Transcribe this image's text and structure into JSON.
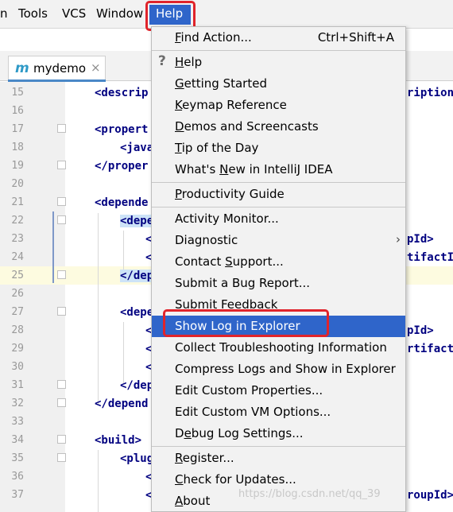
{
  "menubar": {
    "items": [
      "n",
      "Tools",
      "VCS",
      "Window"
    ],
    "active": "Help"
  },
  "tab": {
    "logo": "m",
    "label": "mydemo",
    "close": "×"
  },
  "editor": {
    "line_numbers": [
      "15",
      "16",
      "17",
      "18",
      "19",
      "20",
      "21",
      "22",
      "23",
      "24",
      "25",
      "26",
      "27",
      "28",
      "29",
      "30",
      "31",
      "32",
      "33",
      "34",
      "35",
      "36",
      "37"
    ],
    "left_code": {
      "l15": "<descrip",
      "l17": "<propert",
      "l18": "<java",
      "l19": "</proper",
      "l21": "<depende",
      "l22": "<depe",
      "l23": "<",
      "l24": "<",
      "l25": "</dep",
      "l27": "<depe",
      "l28": "<",
      "l29": "<",
      "l30": "<",
      "l31": "</dep",
      "l32": "</depend",
      "l34": "<build>",
      "l35": "<plug",
      "l36": "<",
      "l37": "<"
    },
    "right_code": {
      "l15": "ription",
      "l22": "pId>",
      "l23": "tifactI",
      "l28": "pId>",
      "l29": "rtifact",
      "l37": "roupId>"
    },
    "watermark": "https://blog.csdn.net/qq_39"
  },
  "help_menu": {
    "groups": [
      [
        {
          "label": "Find Action...",
          "mnemonic": "F",
          "shortcut": "Ctrl+Shift+A"
        }
      ],
      [
        {
          "label": "Help",
          "mnemonic": "H",
          "icon": "?"
        },
        {
          "label": "Getting Started",
          "mnemonic": "G"
        },
        {
          "label": "Keymap Reference",
          "mnemonic": "K"
        },
        {
          "label": "Demos and Screencasts",
          "mnemonic": "D"
        },
        {
          "label": "Tip of the Day",
          "mnemonic": "T"
        },
        {
          "label": "What's New in IntelliJ IDEA",
          "mnemonic": "N"
        }
      ],
      [
        {
          "label": "Productivity Guide",
          "mnemonic": "P"
        }
      ],
      [
        {
          "label": "Activity Monitor..."
        },
        {
          "label": "Diagnostic",
          "submenu": true
        },
        {
          "label": "Contact Support...",
          "mnemonic": "S"
        },
        {
          "label": "Submit a Bug Report..."
        },
        {
          "label": "Submit Feedback"
        },
        {
          "label": "Show Log in Explorer",
          "selected": true
        },
        {
          "label": "Collect Troubleshooting Information"
        },
        {
          "label": "Compress Logs and Show in Explorer"
        },
        {
          "label": "Edit Custom Properties..."
        },
        {
          "label": "Edit Custom VM Options..."
        },
        {
          "label": "Debug Log Settings...",
          "mnemonic": "e"
        }
      ],
      [
        {
          "label": "Register...",
          "mnemonic": "R"
        },
        {
          "label": "Check for Updates...",
          "mnemonic": "C"
        },
        {
          "label": "About",
          "mnemonic": "A"
        }
      ]
    ]
  },
  "colors": {
    "menu_bg": "#f2f2f2",
    "selection": "#2f65ca",
    "annotation": "#e0242b",
    "xml_tag": "#000080",
    "highlight": "#cde3f7"
  }
}
